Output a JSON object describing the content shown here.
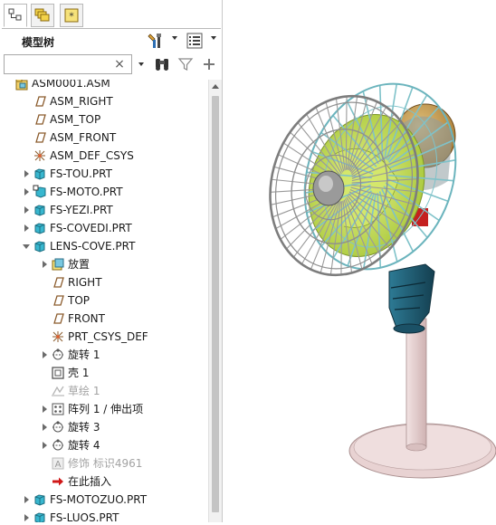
{
  "panel": {
    "title": "模型树",
    "tabs": [
      {
        "icon": "model-tree-icon"
      },
      {
        "icon": "layers-icon"
      },
      {
        "icon": "favorites-icon"
      }
    ],
    "search_value": "",
    "search_clear": "×"
  },
  "tree": [
    {
      "label": "ASM0001.ASM",
      "icon": "assembly-icon",
      "level": 0,
      "expander": "none"
    },
    {
      "label": "ASM_RIGHT",
      "icon": "datum-plane-icon",
      "level": 1,
      "expander": "none"
    },
    {
      "label": "ASM_TOP",
      "icon": "datum-plane-icon",
      "level": 1,
      "expander": "none"
    },
    {
      "label": "ASM_FRONT",
      "icon": "datum-plane-icon",
      "level": 1,
      "expander": "none"
    },
    {
      "label": "ASM_DEF_CSYS",
      "icon": "csys-icon",
      "level": 1,
      "expander": "none"
    },
    {
      "label": "FS-TOU.PRT",
      "icon": "part-icon",
      "level": 1,
      "expander": "collapsed"
    },
    {
      "label": "FS-MOTO.PRT",
      "icon": "part-linked-icon",
      "level": 1,
      "expander": "collapsed"
    },
    {
      "label": "FS-YEZI.PRT",
      "icon": "part-icon",
      "level": 1,
      "expander": "collapsed"
    },
    {
      "label": "FS-COVEDI.PRT",
      "icon": "part-icon",
      "level": 1,
      "expander": "collapsed"
    },
    {
      "label": "LENS-COVE.PRT",
      "icon": "part-icon",
      "level": 1,
      "expander": "expanded"
    },
    {
      "label": "放置",
      "icon": "placement-icon",
      "level": 2,
      "expander": "collapsed"
    },
    {
      "label": "RIGHT",
      "icon": "datum-plane-icon",
      "level": 2,
      "expander": "none"
    },
    {
      "label": "TOP",
      "icon": "datum-plane-icon",
      "level": 2,
      "expander": "none"
    },
    {
      "label": "FRONT",
      "icon": "datum-plane-icon",
      "level": 2,
      "expander": "none"
    },
    {
      "label": "PRT_CSYS_DEF",
      "icon": "csys-icon",
      "level": 2,
      "expander": "none"
    },
    {
      "label": "旋转 1",
      "icon": "revolve-icon",
      "level": 2,
      "expander": "collapsed"
    },
    {
      "label": "壳 1",
      "icon": "shell-icon",
      "level": 2,
      "expander": "none"
    },
    {
      "label": "草绘 1",
      "icon": "sketch-icon",
      "level": 2,
      "expander": "none",
      "dim": true
    },
    {
      "label": "阵列 1 / 伸出项",
      "icon": "pattern-icon",
      "level": 2,
      "expander": "collapsed"
    },
    {
      "label": "旋转 3",
      "icon": "revolve-icon",
      "level": 2,
      "expander": "collapsed"
    },
    {
      "label": "旋转 4",
      "icon": "revolve-icon",
      "level": 2,
      "expander": "collapsed"
    },
    {
      "label": "修饰 标识4961",
      "icon": "cosmetic-icon",
      "level": 2,
      "expander": "none",
      "dim": true
    },
    {
      "label": "在此插入",
      "icon": "insert-here-arrow-icon",
      "level": 2,
      "expander": "none"
    },
    {
      "label": "FS-MOTOZUO.PRT",
      "icon": "part-icon",
      "level": 1,
      "expander": "collapsed"
    },
    {
      "label": "FS-LUOS.PRT",
      "icon": "part-icon",
      "level": 1,
      "expander": "collapsed"
    }
  ],
  "colors": {
    "datum": "#8a5a2b",
    "part": "#38b7cf",
    "grille": "#9a9a9a",
    "blade": "#bcd94a",
    "head": "#1f5c73",
    "motor": "#c9a05a",
    "stand": "#e7d0d0",
    "insert_arrow": "#d01818"
  }
}
